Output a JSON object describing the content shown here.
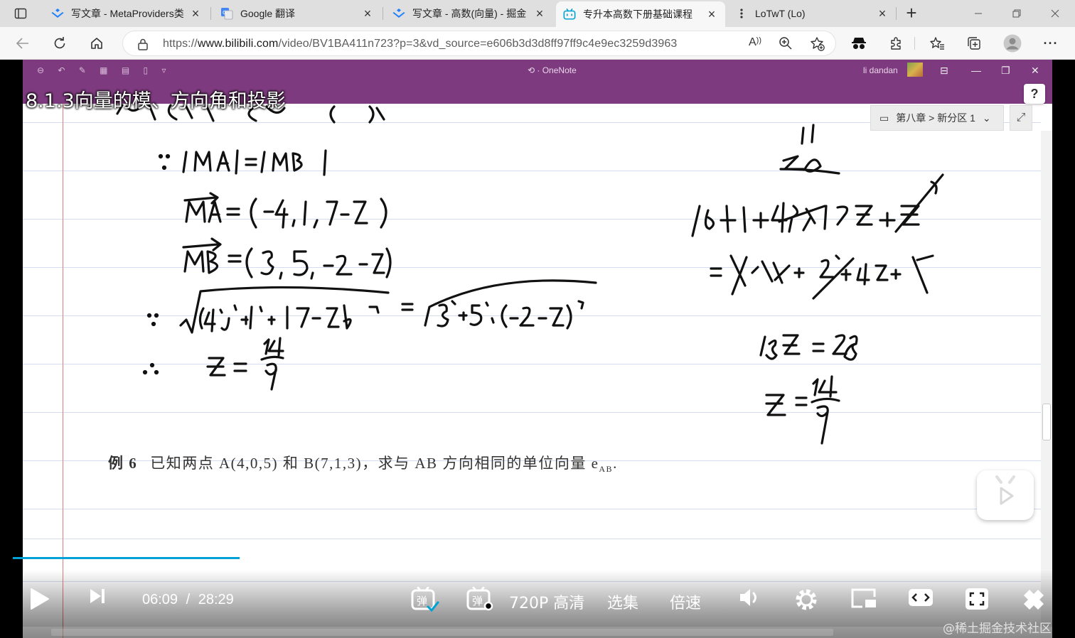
{
  "browser": {
    "tabs": [
      {
        "title": "写文章 - MetaProviders类",
        "icon": "juejin-icon"
      },
      {
        "title": "Google 翻译",
        "icon": "google-translate-icon"
      },
      {
        "title": "写文章 - 高数(向量) - 掘金",
        "icon": "juejin-icon"
      },
      {
        "title": "专升本高数下册基础课程",
        "icon": "bilibili-icon",
        "active": true
      },
      {
        "title": "LoTwT (Lo)",
        "icon": "github-icon"
      }
    ],
    "address": {
      "url_prefix": "https://",
      "url_host": "www.bilibili.com",
      "url_path": "/video/BV1BA411n723?p=3&vd_source=e606b3d3d8ff97ff9c4e9ec3259d3963"
    }
  },
  "onenote": {
    "app_title": "OneNote",
    "user": "li dandan",
    "breadcrumb": "第八章 > 新分区 1",
    "example_num": "例 6",
    "example_text": "已知两点 A(4,0,5) 和 B(7,1,3)，求与 AB 方向相同的单位向量 e",
    "example_sub": "AB"
  },
  "video": {
    "title": "8.1.3向量的模、方向角和投影",
    "current_time": "06:09",
    "time_sep": "/",
    "duration": "28:29",
    "progress": 0.216,
    "quality": "720P 高清",
    "episodes": "选集",
    "speed": "倍速",
    "watermark": "@稀土掘金技术社区"
  },
  "colors": {
    "onenote_purple": "#7d3a7e",
    "progress_blue": "#00a1d6",
    "margin_red": "#e67a7a"
  }
}
